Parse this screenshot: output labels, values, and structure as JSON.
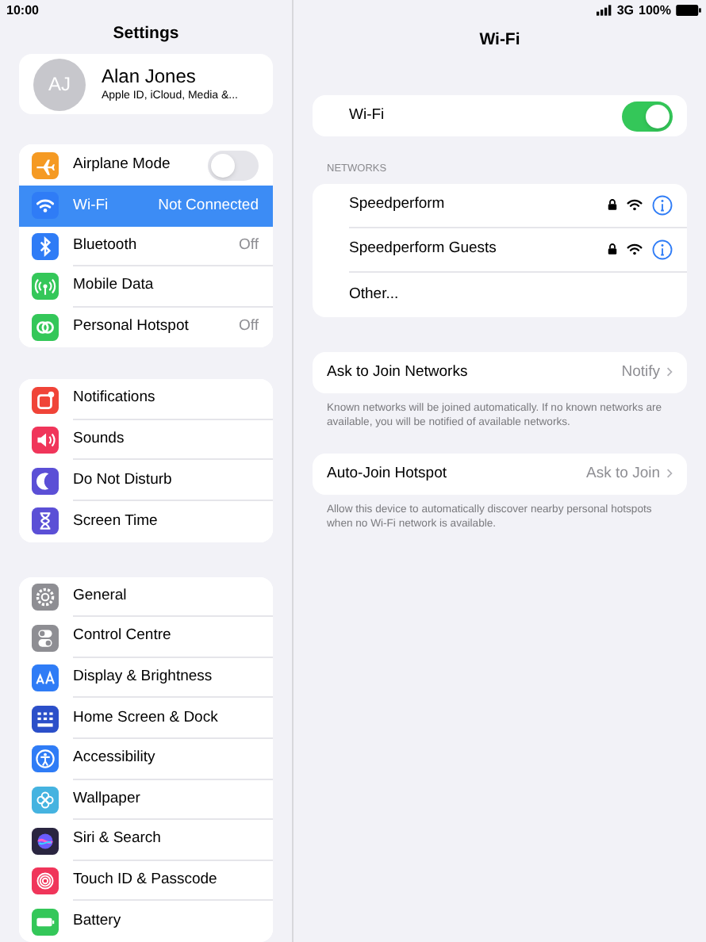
{
  "status_bar": {
    "time": "10:00",
    "network": "3G",
    "battery": "100%"
  },
  "sidebar": {
    "title": "Settings",
    "profile": {
      "initials": "AJ",
      "name": "Alan Jones",
      "subtitle": "Apple ID, iCloud, Media &..."
    },
    "groups": [
      [
        {
          "label": "Airplane Mode",
          "kind": "toggle",
          "on": false,
          "selected": false,
          "color": "#f59a23"
        },
        {
          "label": "Wi-Fi",
          "kind": "value",
          "value": "Not Connected",
          "selected": true,
          "color": "#2f7cf6"
        },
        {
          "label": "Bluetooth",
          "kind": "value",
          "value": "Off",
          "selected": false,
          "color": "#2f7cf6"
        },
        {
          "label": "Mobile Data",
          "kind": "plain",
          "selected": false,
          "color": "#34c759"
        },
        {
          "label": "Personal Hotspot",
          "kind": "value",
          "value": "Off",
          "selected": false,
          "color": "#34c759"
        }
      ],
      [
        {
          "label": "Notifications",
          "kind": "plain",
          "selected": false,
          "color": "#f04438"
        },
        {
          "label": "Sounds",
          "kind": "plain",
          "selected": false,
          "color": "#f0355a"
        },
        {
          "label": "Do Not Disturb",
          "kind": "plain",
          "selected": false,
          "color": "#5b4fd6"
        },
        {
          "label": "Screen Time",
          "kind": "plain",
          "selected": false,
          "color": "#5b4fd6"
        }
      ],
      [
        {
          "label": "General",
          "kind": "plain",
          "selected": false,
          "color": "#8e8e93"
        },
        {
          "label": "Control Centre",
          "kind": "plain",
          "selected": false,
          "color": "#8e8e93"
        },
        {
          "label": "Display & Brightness",
          "kind": "plain",
          "selected": false,
          "color": "#2f7cf6"
        },
        {
          "label": "Home Screen & Dock",
          "kind": "plain",
          "selected": false,
          "color": "#2b4fc9"
        },
        {
          "label": "Accessibility",
          "kind": "plain",
          "selected": false,
          "color": "#2f7cf6"
        },
        {
          "label": "Wallpaper",
          "kind": "plain",
          "selected": false,
          "color": "#45b3e0"
        },
        {
          "label": "Siri & Search",
          "kind": "plain",
          "selected": false,
          "color": "#2a2540"
        },
        {
          "label": "Touch ID & Passcode",
          "kind": "plain",
          "selected": false,
          "color": "#f0355a"
        },
        {
          "label": "Battery",
          "kind": "plain",
          "selected": false,
          "color": "#34c759"
        }
      ]
    ]
  },
  "detail": {
    "title": "Wi-Fi",
    "wifi": {
      "label": "Wi-Fi",
      "on": true
    },
    "networks_header": "NETWORKS",
    "networks": [
      {
        "name": "Speedperform",
        "kind": "network",
        "secured": true
      },
      {
        "name": "Speedperform Guests",
        "kind": "network",
        "secured": true
      },
      {
        "name": "Other...",
        "kind": "other"
      }
    ],
    "settings": [
      {
        "label": "Ask to Join Networks",
        "value": "Notify",
        "footnote": "Known networks will be joined automatically. If no known networks are available, you will be notified of available networks."
      },
      {
        "label": "Auto-Join Hotspot",
        "value": "Ask to Join",
        "footnote": "Allow this device to automatically discover nearby personal hotspots when no Wi-Fi network is available."
      }
    ]
  }
}
